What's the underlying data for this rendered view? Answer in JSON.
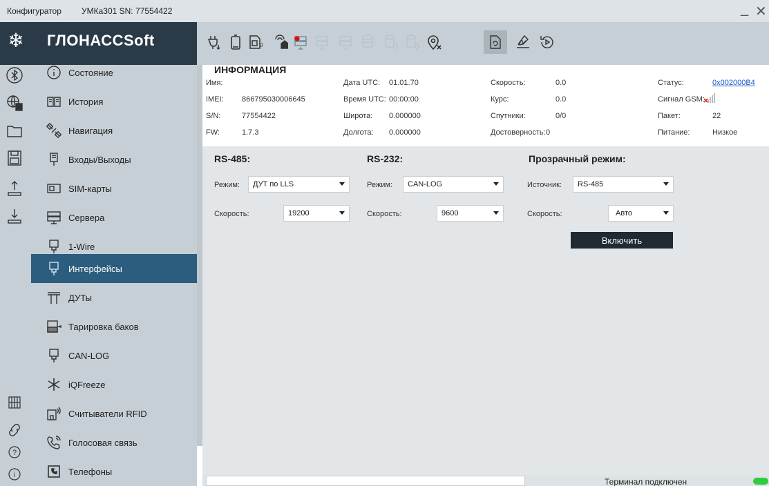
{
  "titlebar": {
    "app": "Конфигуратор",
    "device": "УМКа301 SN: 77554422",
    "minimize": "_",
    "close": "✕"
  },
  "logo": {
    "text": "ГЛОНАССSoft"
  },
  "nav": {
    "items": [
      {
        "label": "Состояние"
      },
      {
        "label": "История"
      },
      {
        "label": "Навигация"
      },
      {
        "label": "Входы/Выходы"
      },
      {
        "label": "SIM-карты"
      },
      {
        "label": "Сервера"
      },
      {
        "label": "1-Wire"
      },
      {
        "label": "Интерфейсы",
        "active": true
      },
      {
        "label": "ДУТы"
      },
      {
        "label": "Тарировка баков"
      },
      {
        "label": "CAN-LOG"
      },
      {
        "label": "iQFreeze"
      },
      {
        "label": "Считыватели RFID"
      },
      {
        "label": "Голосовая связь"
      },
      {
        "label": "Телефоны"
      }
    ]
  },
  "info": {
    "title": "ИНФОРМАЦИЯ",
    "name_label": "Имя:",
    "name": "",
    "imei_label": "IMEI:",
    "imei": "866795030006645",
    "sn_label": "S/N:",
    "sn": "77554422",
    "fw_label": "FW:",
    "fw": "1.7.3",
    "date_label": "Дата UTC:",
    "date": "01.01.70",
    "time_label": "Время UTC:",
    "time": "00:00:00",
    "lat_label": "Широта:",
    "lat": "0.000000",
    "lon_label": "Долгота:",
    "lon": "0.000000",
    "speed_label": "Скорость:",
    "speed": "0.0",
    "course_label": "Курс:",
    "course": "0.0",
    "sats_label": "Спутники:",
    "sats": "0/0",
    "valid_label": "Достоверность:",
    "valid": "0",
    "status_label": "Статус:",
    "status": "0x002000B4",
    "gsm_label": "Сигнал GSM:",
    "packet_label": "Пакет:",
    "packet": "22",
    "power_label": "Питание:",
    "power": "Низкое"
  },
  "rs485": {
    "title": "RS-485:",
    "mode_label": "Режим:",
    "mode": "ДУТ по LLS",
    "speed_label": "Скорость:",
    "speed": "19200"
  },
  "rs232": {
    "title": "RS-232:",
    "mode_label": "Режим:",
    "mode": "CAN-LOG",
    "speed_label": "Скорость:",
    "speed": "9600"
  },
  "transparent": {
    "title": "Прозрачный режим:",
    "source_label": "Источник:",
    "source": "RS-485",
    "speed_label": "Скорость:",
    "speed": "Авто",
    "enable_button": "Включить"
  },
  "status_bar": {
    "text": "Терминал подключен"
  },
  "colors": {
    "nav_active": "#2c5d7e",
    "logo_bg": "#2a3a47",
    "sidebar_bg": "#c6cfd5",
    "status_led": "#2ecc40",
    "link": "#1a56c9"
  }
}
